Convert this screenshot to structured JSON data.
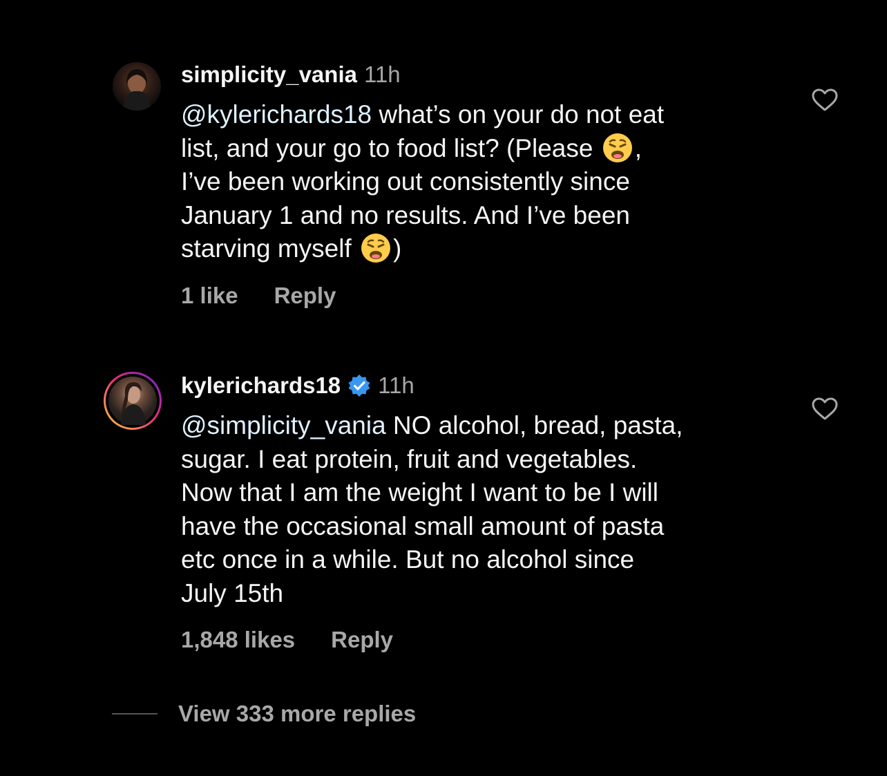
{
  "comments": [
    {
      "username": "simplicity_vania",
      "time": "11h",
      "mention": "@kylerichards18",
      "lines": [
        " what’s on your do not eat",
        "list, and your go to food list? (Please ",
        ",",
        "I’ve been working out consistently since",
        "January 1 and no results. And I’ve been",
        "starving myself ",
        ")"
      ],
      "likes": "1 like",
      "reply_label": "Reply"
    },
    {
      "username": "kylerichards18",
      "time": "11h",
      "verified": true,
      "mention": "@simplicity_vania",
      "lines": [
        " NO alcohol, bread, pasta,",
        "sugar. I eat protein, fruit and vegetables.",
        "Now that I am the weight I want to be I will",
        "have the occasional small amount of pasta",
        "etc once in a while. But no alcohol since",
        "July 15th"
      ],
      "likes": "1,848 likes",
      "reply_label": "Reply"
    }
  ],
  "view_more": "View 333 more replies",
  "icons": {
    "like": "heart-outline-icon",
    "verified": "verified-badge-icon",
    "emoji": "weary-face-emoji"
  },
  "colors": {
    "background": "#000000",
    "text": "#f5f5f5",
    "secondary": "#a8a8a8",
    "verified": "#3897f0"
  }
}
